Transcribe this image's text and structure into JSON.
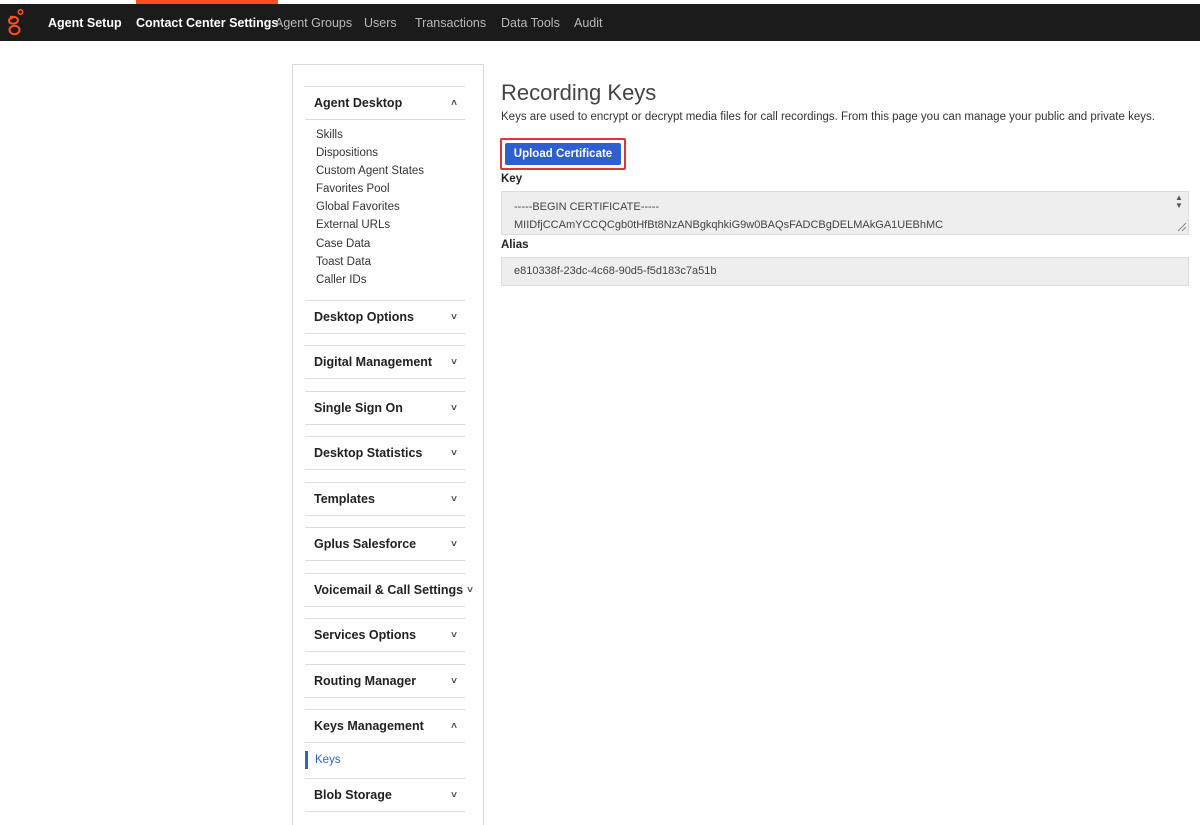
{
  "nav": {
    "brand_label": "Agent Setup",
    "items": [
      "Contact Center Settings",
      "Agent Groups",
      "Users",
      "Transactions",
      "Data Tools",
      "Audit"
    ],
    "active_index": 0,
    "accent_color": "#ff4f1f"
  },
  "sidebar": {
    "agent_desktop": {
      "label": "Agent Desktop",
      "expanded": true,
      "items": [
        "Skills",
        "Dispositions",
        "Custom Agent States",
        "Favorites Pool",
        "Global Favorites",
        "External URLs",
        "Case Data",
        "Toast Data",
        "Caller IDs"
      ]
    },
    "sections": [
      "Desktop Options",
      "Digital Management",
      "Single Sign On",
      "Desktop Statistics",
      "Templates",
      "Gplus Salesforce",
      "Voicemail & Call Settings",
      "Services Options",
      "Routing Manager"
    ],
    "keys_management": {
      "label": "Keys Management",
      "expanded": true,
      "items": [
        "Keys"
      ],
      "selected": "Keys"
    },
    "blob_storage": {
      "label": "Blob Storage"
    },
    "icons": {
      "expanded": "chevron-up-icon",
      "collapsed": "chevron-down-icon"
    }
  },
  "main": {
    "title": "Recording Keys",
    "description": "Keys are used to encrypt or decrypt media files for call recordings. From this page you can manage your public and private keys.",
    "upload_button": "Upload Certificate",
    "key_label": "Key",
    "key_value_lines": [
      "-----BEGIN CERTIFICATE-----",
      "MIIDfjCCAmYCCQCgb0tHfBt8NzANBgkqhkiG9w0BAQsFADCBgDELMAkGA1UEBhMC"
    ],
    "alias_label": "Alias",
    "alias_value": "e810338f-23dc-4c68-90d5-f5d183c7a51b",
    "button_color": "#2d5fce",
    "highlight_color": "#e0323f"
  }
}
